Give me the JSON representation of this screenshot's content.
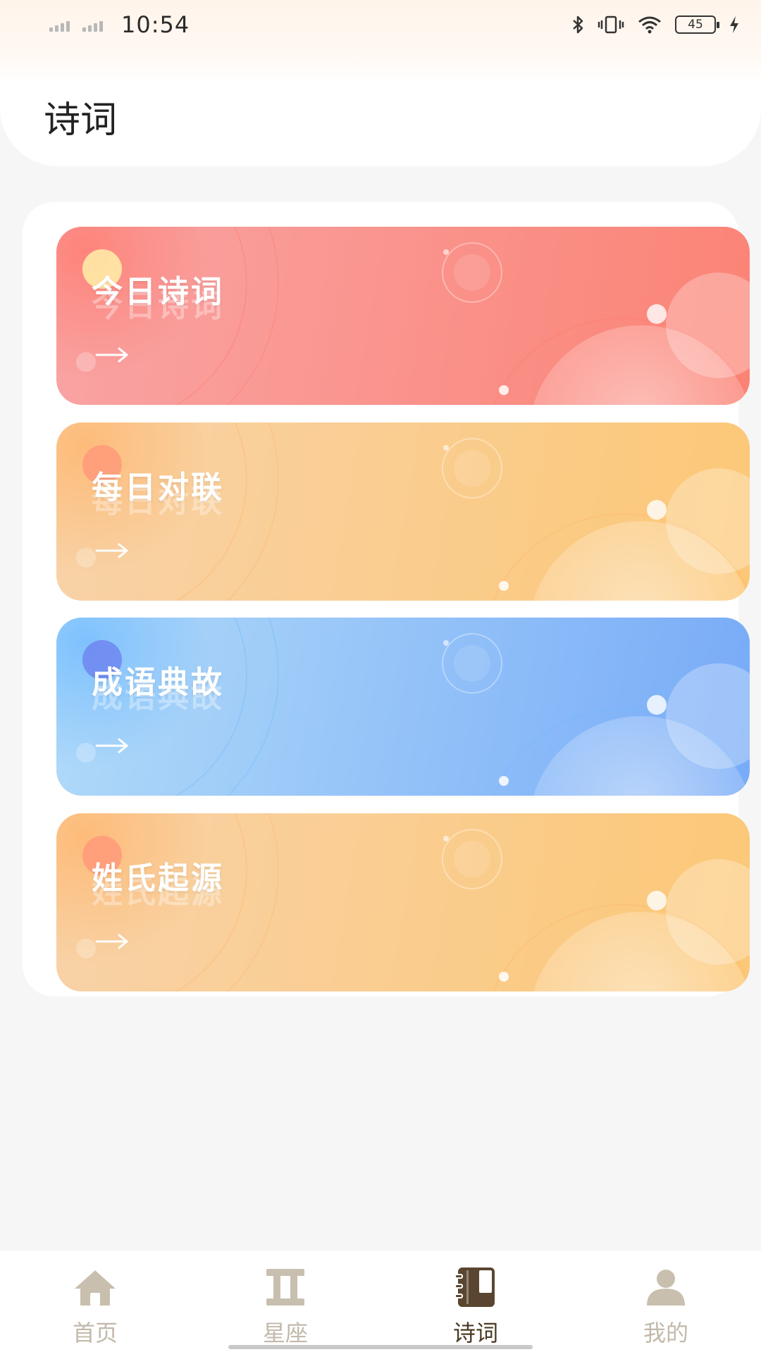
{
  "status_bar": {
    "time": "10:54",
    "battery": "45",
    "icons": [
      "signal-icon",
      "signal-icon",
      "bluetooth-icon",
      "vibrate-icon",
      "wifi-icon",
      "battery-icon",
      "charging-icon"
    ]
  },
  "header": {
    "title": "诗词"
  },
  "cards": [
    {
      "title": "今日诗词",
      "theme": "red",
      "colors": [
        "#f9a4a4",
        "#fb8375"
      ]
    },
    {
      "title": "每日对联",
      "theme": "orange",
      "colors": [
        "#f8d2a8",
        "#fcc877"
      ]
    },
    {
      "title": "成语典故",
      "theme": "blue",
      "colors": [
        "#b0daf9",
        "#78abf7"
      ]
    },
    {
      "title": "姓氏起源",
      "theme": "orange",
      "colors": [
        "#f8d2a8",
        "#fcc877"
      ]
    }
  ],
  "nav": {
    "items": [
      {
        "label": "首页",
        "icon": "home-icon"
      },
      {
        "label": "星座",
        "icon": "gemini-icon"
      },
      {
        "label": "诗词",
        "icon": "book-icon",
        "active": true
      },
      {
        "label": "我的",
        "icon": "user-icon"
      }
    ],
    "active_color": "#4b3a24",
    "inactive_color": "#c2b9aa"
  }
}
